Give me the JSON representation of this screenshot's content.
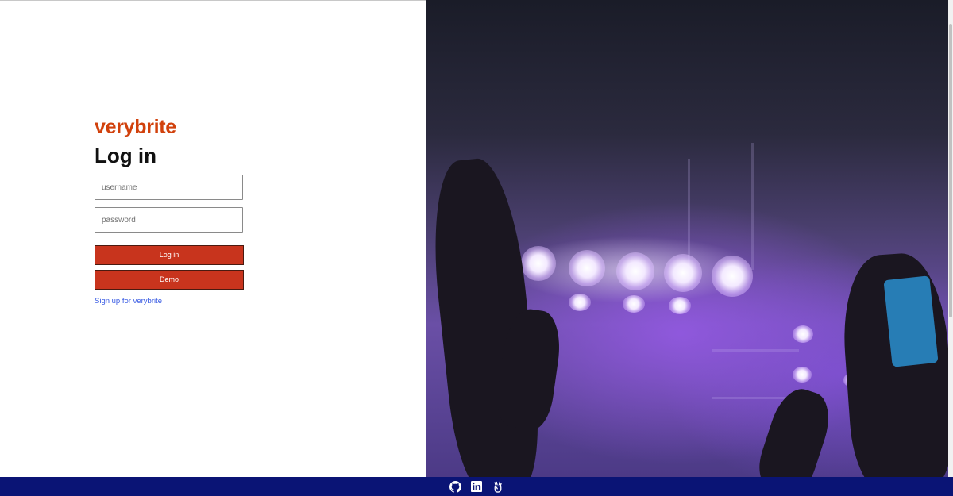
{
  "brand": {
    "name": "verybrite",
    "color": "#d1410c"
  },
  "login": {
    "title": "Log in",
    "username_placeholder": "username",
    "password_placeholder": "password",
    "login_label": "Log in",
    "demo_label": "Demo",
    "signup_link": "Sign up for verybrite",
    "button_color": "#c8341d"
  },
  "hero": {
    "icon": "concert-crowd-image"
  },
  "footer": {
    "background": "#0a1475",
    "icons": [
      "github-icon",
      "linkedin-icon",
      "angellist-icon"
    ]
  }
}
